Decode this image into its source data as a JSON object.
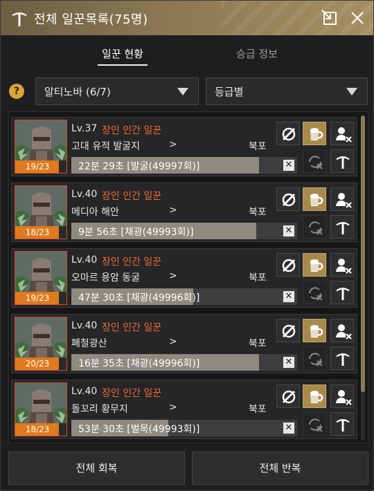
{
  "window": {
    "title": "전체 일꾼목록(75명)"
  },
  "tabs": [
    {
      "label": "일꾼 현황",
      "active": true
    },
    {
      "label": "승급 정보",
      "active": false
    }
  ],
  "filters": {
    "help": "?",
    "region": "알티노바 (6/7)",
    "sort": "등급별"
  },
  "workers": [
    {
      "level": "Lv.37",
      "class": "장인 인간 일꾼",
      "location": "고대 유적 발굴지",
      "arrow": ">",
      "destination": "북포",
      "stamina": "19/23",
      "progress_text": "22분 29초 [발굴(49997회)]",
      "progress": 0.83
    },
    {
      "level": "Lv.40",
      "class": "장인 인간 일꾼",
      "location": "메디아 해안",
      "arrow": ">",
      "destination": "북포",
      "stamina": "18/23",
      "progress_text": "9분 56초 [채광(49993회)]",
      "progress": 0.82
    },
    {
      "level": "Lv.40",
      "class": "장인 인간 일꾼",
      "location": "오마르 용암 동굴",
      "arrow": ">",
      "destination": "북포",
      "stamina": "19/23",
      "progress_text": "47분 30초 [채광(49996회)]",
      "progress": 0.54
    },
    {
      "level": "Lv.40",
      "class": "장인 인간 일꾼",
      "location": "폐철광산",
      "arrow": ">",
      "destination": "북포",
      "stamina": "20/23",
      "progress_text": "16분 35초 [채광(49996회)]",
      "progress": 0.83
    },
    {
      "level": "Lv.40",
      "class": "장인 인간 일꾼",
      "location": "돌꼬리 황무지",
      "arrow": ">",
      "destination": "북포",
      "stamina": "18/23",
      "progress_text": "53분 30초 [벌목(49993회)]",
      "progress": 0.43
    }
  ],
  "bottom": {
    "recover_all": "전체 회복",
    "repeat_all": "전체 반복"
  },
  "colors": {
    "accent": "#a88a4c",
    "class_text": "#ef6a2c",
    "stamina_badge": "#e07a1f"
  },
  "icons": [
    "pickaxe-icon",
    "popout-icon",
    "close-icon",
    "hide-icon",
    "beer-icon",
    "fire-worker-icon",
    "repeat-icon",
    "pickaxe-icon"
  ]
}
